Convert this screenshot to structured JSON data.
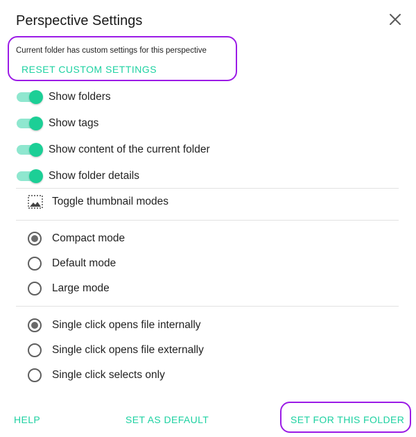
{
  "dialog": {
    "title": "Perspective Settings",
    "close_icon": "close-icon"
  },
  "notice": {
    "text": "Current folder has custom settings for this perspective",
    "reset_label": "RESET CUSTOM SETTINGS"
  },
  "switches": [
    {
      "label": "Show folders",
      "on": true
    },
    {
      "label": "Show tags",
      "on": true
    },
    {
      "label": "Show content of the current folder",
      "on": true
    },
    {
      "label": "Show folder details",
      "on": true
    }
  ],
  "thumbnail": {
    "label": "Toggle thumbnail modes",
    "icon": "image-frame-icon"
  },
  "size_modes": [
    {
      "label": "Compact mode",
      "checked": true
    },
    {
      "label": "Default mode",
      "checked": false
    },
    {
      "label": "Large mode",
      "checked": false
    }
  ],
  "click_modes": [
    {
      "label": "Single click opens file internally",
      "checked": true
    },
    {
      "label": "Single click opens file externally",
      "checked": false
    },
    {
      "label": "Single click selects only",
      "checked": false
    }
  ],
  "actions": {
    "help": "HELP",
    "set_default": "SET AS DEFAULT",
    "set_folder": "SET FOR THIS FOLDER"
  },
  "colors": {
    "accent": "#1dd1a1",
    "highlight": "#9b1be6",
    "switch_thumb": "#1ccf96",
    "switch_track": "#8fe7cf"
  }
}
